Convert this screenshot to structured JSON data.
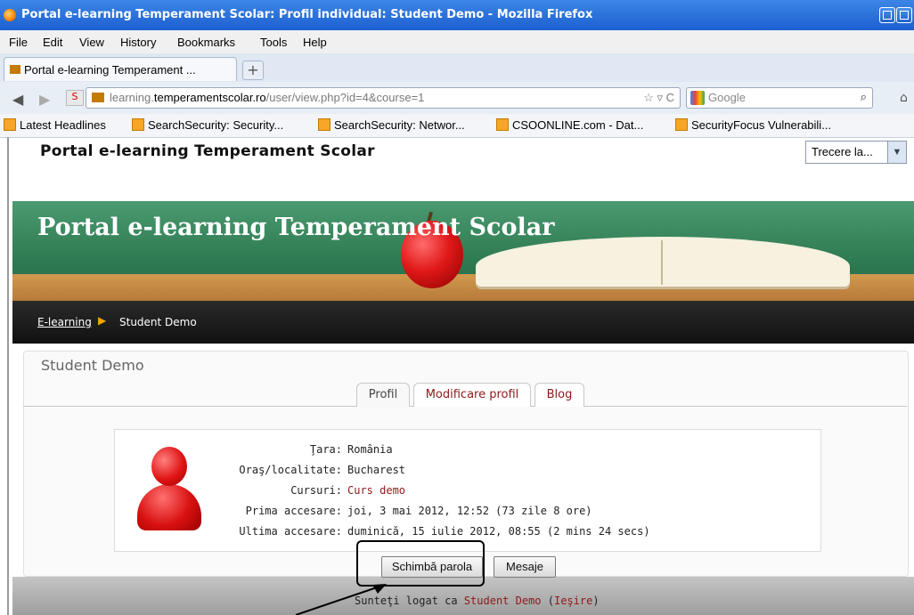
{
  "window": {
    "title": "Portal e-learning Temperament Scolar: Profil individual: Student Demo - Mozilla Firefox"
  },
  "menu": [
    "File",
    "Edit",
    "View",
    "History",
    "Bookmarks",
    "Tools",
    "Help"
  ],
  "tab": {
    "label": "Portal e-learning Temperament ...",
    "new_tab": "+"
  },
  "nav": {
    "url_prefix": "learning.",
    "url_domain": "temperamentscolar.ro",
    "url_suffix": "/user/view.php?id=4&course=1",
    "url_icons": "☆ ▿ C",
    "search_placeholder": "Google"
  },
  "bookmarks": [
    "Latest Headlines",
    "SearchSecurity: Security...",
    "SearchSecurity: Networ...",
    "CSOONLINE.com - Dat...",
    "SecurityFocus Vulnerabili..."
  ],
  "site": {
    "title": "Portal e-learning Temperament Scolar",
    "jump_label": "Trecere la...",
    "banner_title": "Portal e-learning Temperament Scolar"
  },
  "breadcrumb": {
    "home": "E-learning",
    "separator": "▶",
    "current": "Student Demo"
  },
  "profile": {
    "heading": "Student Demo",
    "tabs": [
      "Profil",
      "Modificare profil",
      "Blog"
    ],
    "fields": [
      {
        "label": "Ţara:",
        "value": "România",
        "link": false
      },
      {
        "label": "Oraş/localitate:",
        "value": "Bucharest",
        "link": false
      },
      {
        "label": "Cursuri:",
        "value": "Curs demo",
        "link": true
      },
      {
        "label": "Prima accesare:",
        "value": "joi, 3 mai 2012, 12:52  (73 zile 8 ore)",
        "link": false
      },
      {
        "label": "Ultima accesare:",
        "value": "duminică, 15 iulie 2012, 08:55  (2 mins 24 secs)",
        "link": false
      }
    ],
    "buttons": {
      "change_password": "Schimbă parola",
      "messages": "Mesaje"
    }
  },
  "footer": {
    "prefix": "Sunteţi logat ca",
    "user": "Student Demo",
    "logout": "Ieşire"
  },
  "colors": {
    "titlebar": "#1d5fd0",
    "banner_green": "#2e7a52",
    "link_red": "#8b1a1a",
    "breadcrumb_bg": "#1a1a1a",
    "separator_orange": "#f0a500"
  }
}
